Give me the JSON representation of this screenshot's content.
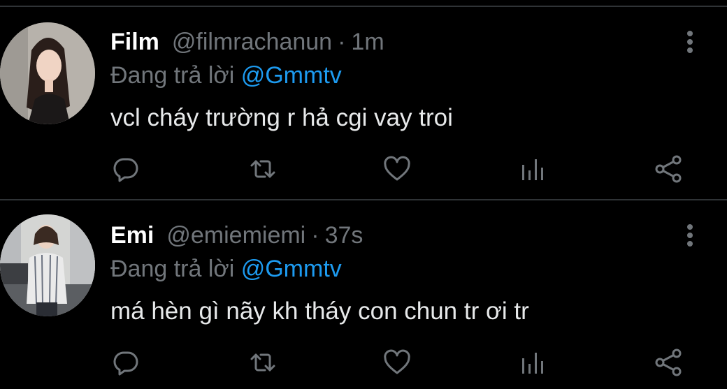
{
  "colors": {
    "background": "#000000",
    "divider": "#2f3336",
    "name": "#ffffff",
    "muted": "#71767b",
    "link": "#1d9bf0",
    "body": "#e7e9ea",
    "icon": "#71767b"
  },
  "tweets": [
    {
      "name": "Film",
      "handle": "@filmrachanun",
      "separator": "·",
      "time": "1m",
      "reply_prefix": "Đang trả lời",
      "reply_to": "@Gmmtv",
      "text": "vcl cháy trường r hả cgi vay troi",
      "actions": [
        "reply-icon",
        "retweet-icon",
        "like-icon",
        "stats-icon",
        "share-icon"
      ],
      "more": "more-options-icon"
    },
    {
      "name": "Emi",
      "handle": "@emiemiemi",
      "separator": "·",
      "time": "37s",
      "reply_prefix": "Đang trả lời",
      "reply_to": "@Gmmtv",
      "text": "má hèn gì nãy kh tháy con chun tr ơi tr",
      "actions": [
        "reply-icon",
        "retweet-icon",
        "like-icon",
        "stats-icon",
        "share-icon"
      ],
      "more": "more-options-icon"
    }
  ]
}
